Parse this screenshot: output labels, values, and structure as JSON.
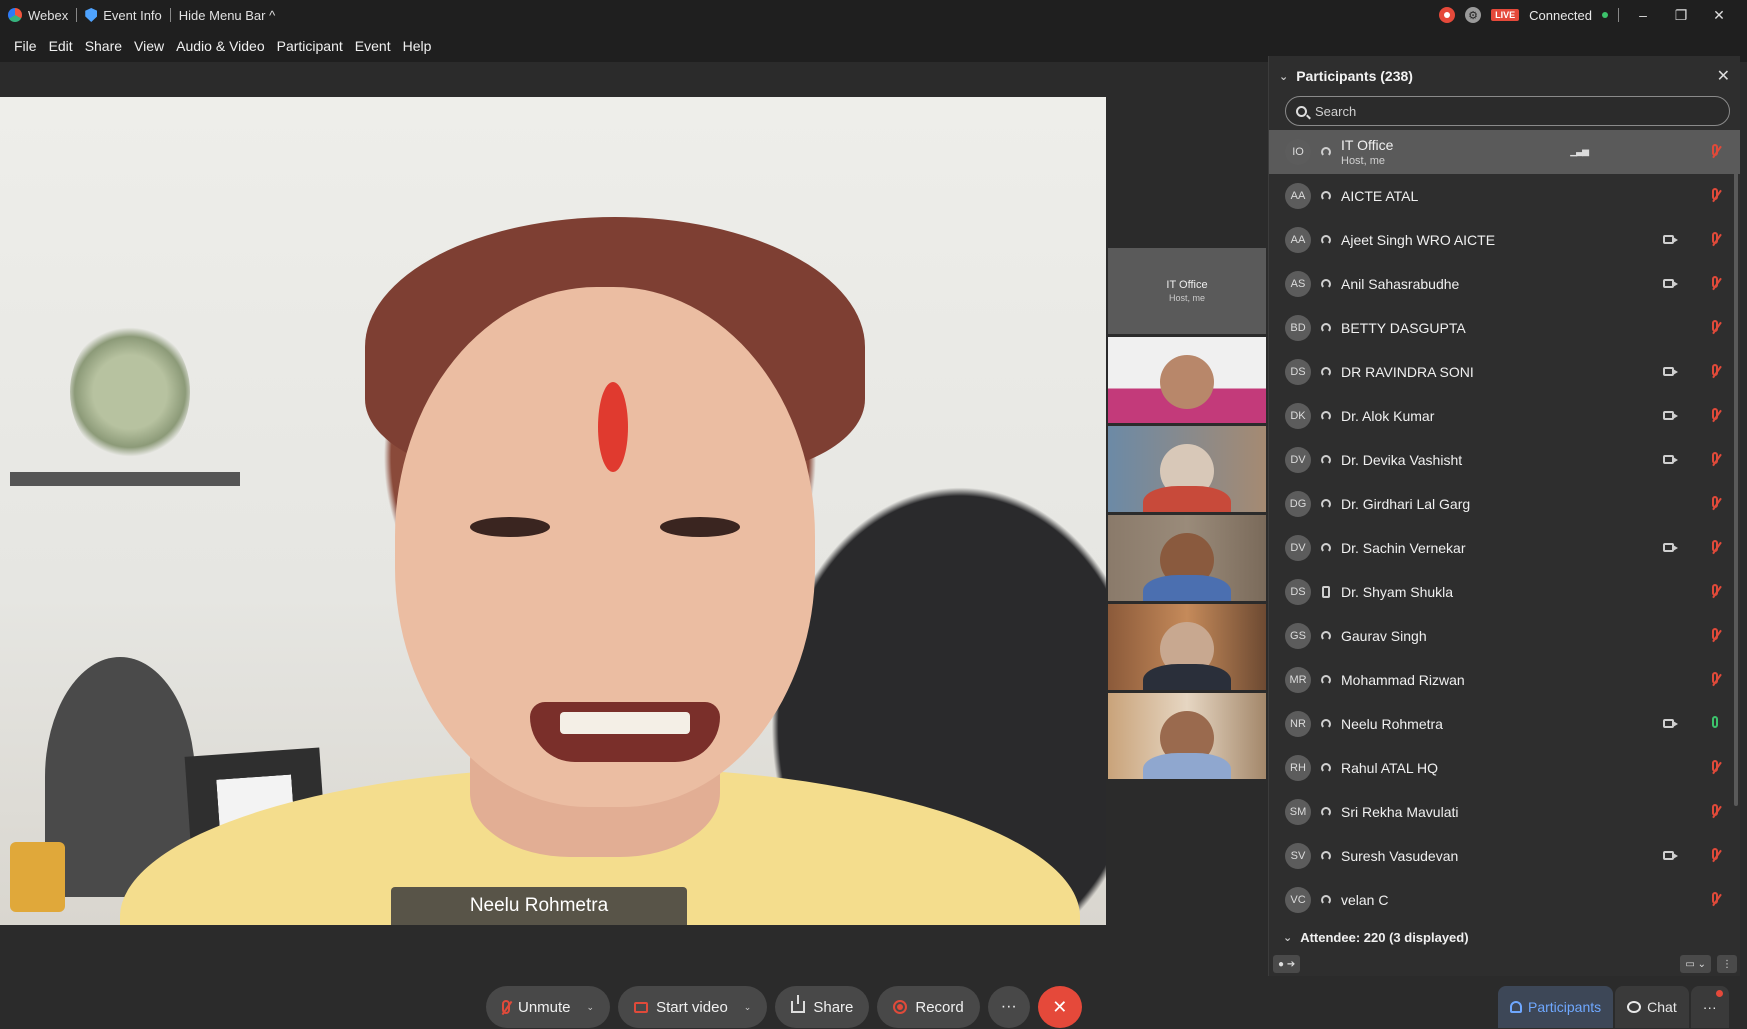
{
  "titlebar": {
    "app_name": "Webex",
    "event_info": "Event Info",
    "hide_menu": "Hide Menu Bar ^",
    "live_badge": "LIVE",
    "status": "Connected",
    "minimize": "–",
    "restore": "❐",
    "close": "✕"
  },
  "menu": [
    "File",
    "Edit",
    "Share",
    "View",
    "Audio & Video",
    "Participant",
    "Event",
    "Help"
  ],
  "main_video": {
    "speaker_name": "Neelu Rohmetra"
  },
  "thumbs": {
    "host_name": "IT Office",
    "host_sub": "Host, me"
  },
  "panel": {
    "title": "Participants (238)",
    "search_placeholder": "Search",
    "attendee_header": "Attendee: 220 (3 displayed)",
    "participants": [
      {
        "initials": "IO",
        "name": "IT Office",
        "sub": "Host, me",
        "video": false,
        "mic": "muted",
        "device": "headset"
      },
      {
        "initials": "AA",
        "name": "AICTE ATAL",
        "video": false,
        "mic": "muted",
        "device": "headset"
      },
      {
        "initials": "AA",
        "name": "Ajeet Singh WRO AICTE",
        "video": true,
        "mic": "muted",
        "device": "headset"
      },
      {
        "initials": "AS",
        "name": "Anil Sahasrabudhe",
        "video": true,
        "mic": "muted",
        "device": "headset"
      },
      {
        "initials": "BD",
        "name": "BETTY DASGUPTA",
        "video": false,
        "mic": "muted",
        "device": "headset"
      },
      {
        "initials": "DS",
        "name": "DR RAVINDRA SONI",
        "video": true,
        "mic": "muted",
        "device": "headset"
      },
      {
        "initials": "DK",
        "name": "Dr. Alok Kumar",
        "video": true,
        "mic": "muted",
        "device": "headset"
      },
      {
        "initials": "DV",
        "name": "Dr. Devika Vashisht",
        "video": true,
        "mic": "muted",
        "device": "headset"
      },
      {
        "initials": "DG",
        "name": "Dr. Girdhari Lal Garg",
        "video": false,
        "mic": "muted",
        "device": "headset"
      },
      {
        "initials": "DV",
        "name": "Dr. Sachin Vernekar",
        "video": true,
        "mic": "muted",
        "device": "headset"
      },
      {
        "initials": "DS",
        "name": "Dr. Shyam Shukla",
        "video": false,
        "mic": "muted",
        "device": "phone"
      },
      {
        "initials": "GS",
        "name": "Gaurav Singh",
        "video": false,
        "mic": "muted",
        "device": "headset"
      },
      {
        "initials": "MR",
        "name": "Mohammad Rizwan",
        "video": false,
        "mic": "muted",
        "device": "headset"
      },
      {
        "initials": "NR",
        "name": "Neelu Rohmetra",
        "video": true,
        "mic": "on",
        "device": "headset"
      },
      {
        "initials": "RH",
        "name": "Rahul ATAL HQ",
        "video": false,
        "mic": "muted",
        "device": "headset"
      },
      {
        "initials": "SM",
        "name": "Sri Rekha Mavulati",
        "video": false,
        "mic": "muted",
        "device": "headset"
      },
      {
        "initials": "SV",
        "name": "Suresh Vasudevan",
        "video": true,
        "mic": "muted",
        "device": "headset"
      },
      {
        "initials": "VC",
        "name": "velan C",
        "video": false,
        "mic": "muted",
        "device": "headset"
      }
    ]
  },
  "toolbar": {
    "unmute": "Unmute",
    "start_video": "Start video",
    "share": "Share",
    "record": "Record",
    "more": "···",
    "leave": "✕"
  },
  "right_tabs": {
    "participants": "Participants",
    "chat": "Chat",
    "more": "···"
  },
  "colors": {
    "accent": "#6fa8ff",
    "danger": "#e5493a",
    "mic_on": "#3cc26b"
  }
}
